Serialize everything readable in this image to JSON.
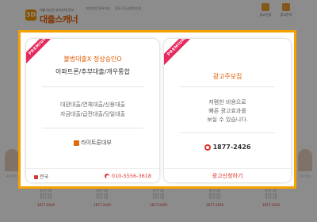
{
  "header": {
    "logo_mark": "3D",
    "logo_tagline": "대출가능한 대부업체 정보",
    "logo_name": "대출스캐너",
    "top_links": [
      "대부업체 등록조회",
      "2023 등급판정기관"
    ],
    "top_icons": [
      "광고신청",
      "광고문의"
    ]
  },
  "popup": {
    "left_card": {
      "ribbon": "PREMIUM",
      "headline": "불법대출X 정상승인O",
      "subline": "아파트론/추부대출/개우통합",
      "body": [
        "대환대출/연체대출/신용대출",
        "자금대출/급전대출/당일대출"
      ],
      "sign": "라이트론대부",
      "region": "전국",
      "phone": "010-5556-3618"
    },
    "right_card": {
      "ribbon": "PREMIUM",
      "headline": "광고주모집",
      "body": [
        "저렴한 비용으로",
        "빠른 광고효과를",
        "보실 수 있습니다."
      ],
      "phone": "1877-2426",
      "apply": "광고신청하기"
    }
  },
  "background_grid": {
    "cells": [
      {
        "lines": [
          "광고주 모집",
          "광고주 모집",
          "광고주 모집"
        ],
        "phone": "1877-2426"
      },
      {
        "lines": [
          "광고주 모집",
          "광고주 모집",
          "광고주 모집"
        ],
        "phone": "1877-2426"
      },
      {
        "lines": [
          "광고주 모집",
          "광고주 모집",
          "광고주 모집"
        ],
        "phone": "1877-2426"
      },
      {
        "lines": [
          "광고주 모집",
          "광고주 모집",
          "광고주 모집"
        ],
        "phone": "1877-2426"
      },
      {
        "lines": [
          "광고주 모집",
          "광고주 모집",
          "광고주 모집"
        ],
        "phone": "1877-2426"
      }
    ],
    "side_left": "대출스캐너",
    "side_right": "대출스캐너"
  },
  "colors": {
    "accent": "#f5a200",
    "headline": "#e05a00",
    "phone": "#e03030",
    "ribbon": "#e52b5e"
  }
}
